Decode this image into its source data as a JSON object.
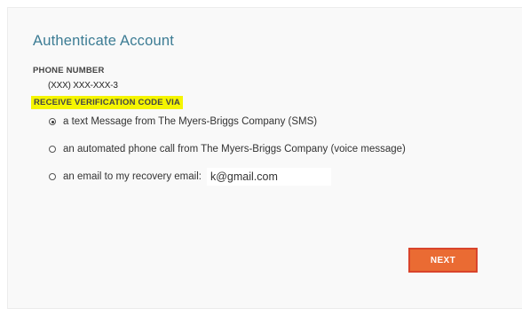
{
  "title": "Authenticate Account",
  "phone": {
    "label": "PHONE NUMBER",
    "value": "(XXX) XXX-XXX-3"
  },
  "verification": {
    "label": "RECEIVE VERIFICATION CODE VIA",
    "options": [
      {
        "label": "a text Message from The Myers-Briggs Company (SMS)",
        "selected": true
      },
      {
        "label": "an automated phone call from The Myers-Briggs Company (voice message)",
        "selected": false
      },
      {
        "label": "an email to my recovery email:",
        "selected": false
      }
    ],
    "recovery_email": "k@gmail.com"
  },
  "next_button": {
    "label": "NEXT"
  },
  "colors": {
    "title": "#3c7c94",
    "highlight": "#f5f500",
    "button": "#ea6b33",
    "button_border": "#d9442b"
  }
}
